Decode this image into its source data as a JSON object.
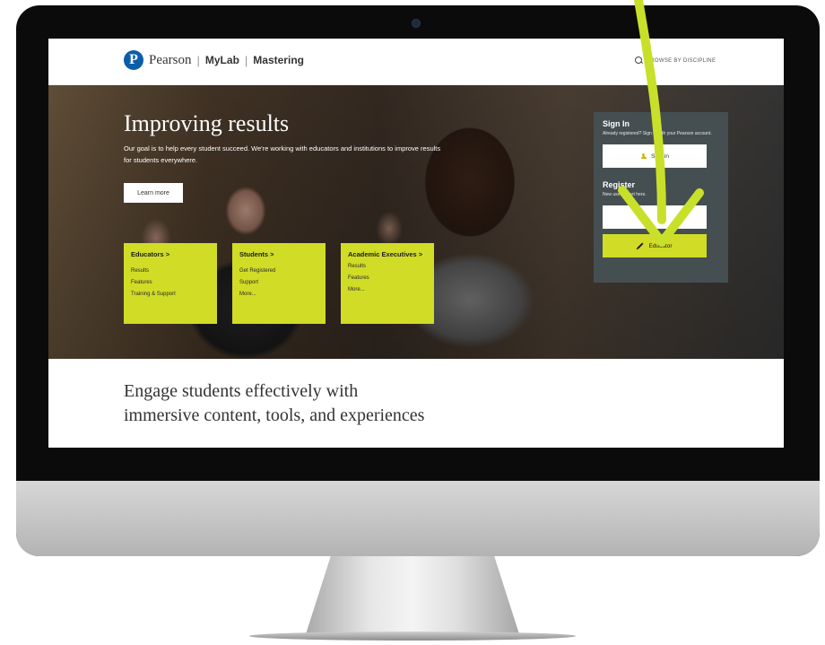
{
  "header": {
    "brand": "Pearson",
    "separator": "|",
    "product_left": "MyLab",
    "product_right": "Mastering",
    "browse_label": "BROWSE BY DISCIPLINE"
  },
  "hero": {
    "title": "Improving results",
    "subtitle": "Our goal is to help every student succeed. We're working with educators and institutions to improve results for students everywhere.",
    "learn_more": "Learn more"
  },
  "cards": [
    {
      "title": "Educators  >",
      "links": [
        "Results",
        "Features",
        "Training & Support"
      ]
    },
    {
      "title": "Students  >",
      "links": [
        "Get Registered",
        "Support",
        "More..."
      ]
    },
    {
      "title": "Academic Executives  >",
      "links": [
        "Results",
        "Features",
        "More..."
      ]
    }
  ],
  "signin": {
    "heading": "Sign In",
    "description": "Already registered? Sign in with your Pearson account.",
    "button": "Sign in",
    "register_heading": "Register",
    "register_description": "New user? Start here.",
    "educator_button": "Educator"
  },
  "engage": {
    "heading": "Engage students effectively with immersive content, tools, and experiences"
  },
  "colors": {
    "accent": "#d1dc26",
    "arrow": "#c8e02a",
    "panel": "#454f52",
    "brand_blue": "#0a5ea8"
  }
}
